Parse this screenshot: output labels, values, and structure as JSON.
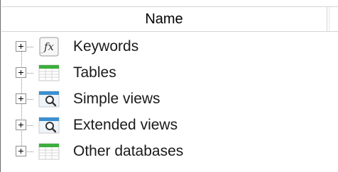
{
  "header": {
    "name_label": "Name"
  },
  "tree": {
    "items": [
      {
        "label": "Keywords",
        "icon": "function-icon"
      },
      {
        "label": "Tables",
        "icon": "table-icon"
      },
      {
        "label": "Simple views",
        "icon": "view-icon"
      },
      {
        "label": "Extended views",
        "icon": "view-icon"
      },
      {
        "label": "Other databases",
        "icon": "table-icon"
      }
    ]
  },
  "colors": {
    "table_header": "#3cae3c",
    "view_header": "#3a8fd0",
    "tree_line": "#8a8a8a"
  }
}
